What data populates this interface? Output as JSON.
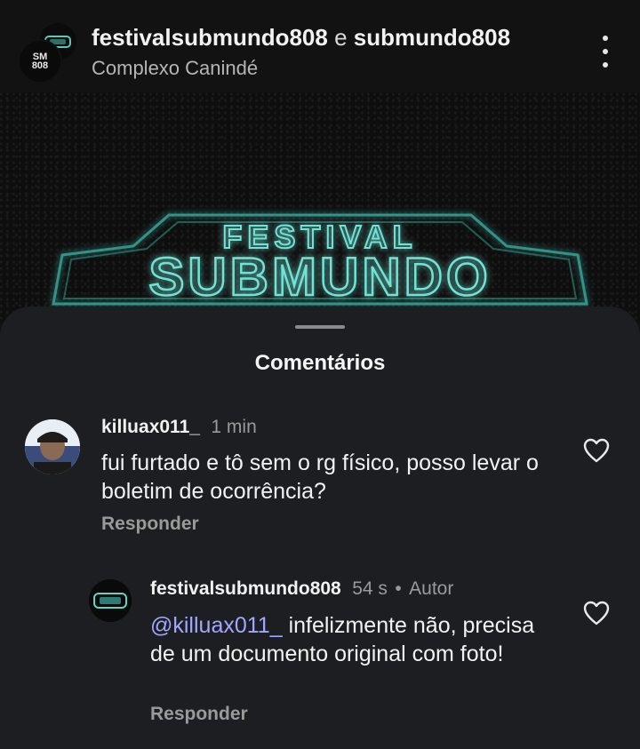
{
  "post": {
    "author1": "festivalsubmundo808",
    "connector": "e",
    "author2": "submundo808",
    "location": "Complexo Canindé",
    "avatar_text_line1": "SM",
    "avatar_text_line2": "808",
    "more_icon": "more-vertical-icon"
  },
  "media": {
    "logo_line1": "FESTIVAL",
    "logo_line2": "SUBMUNDO",
    "glow_color": "#4fd6c8"
  },
  "comments_sheet": {
    "title": "Comentários",
    "comments": [
      {
        "username": "killuax011_",
        "time": "1 min",
        "text": "fui furtado e tô sem o rg físico, posso levar o boletim de ocorrência?",
        "reply_label": "Responder",
        "like_icon": "heart-outline-icon"
      },
      {
        "username": "festivalsubmundo808",
        "time": "54 s",
        "badge": "Autor",
        "mention": "@killuax011_",
        "text": "infelizmente não, precisa de um documento original com foto!",
        "reply_label": "Responder",
        "like_icon": "heart-outline-icon"
      }
    ]
  },
  "colors": {
    "background": "#121212",
    "sheet": "#1c1e21",
    "mention": "#a3a6ff",
    "muted": "#9a9a9a"
  }
}
